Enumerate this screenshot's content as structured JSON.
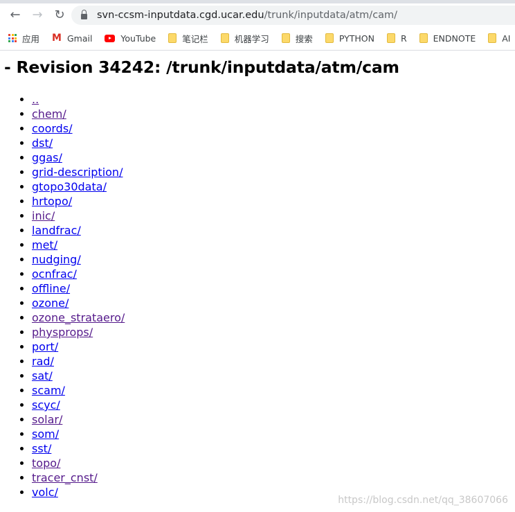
{
  "browser": {
    "url_host": "svn-ccsm-inputdata.cgd.ucar.edu",
    "url_path": "/trunk/inputdata/atm/cam/",
    "bookmarks": [
      {
        "label": "应用",
        "icon": "apps-grid-icon"
      },
      {
        "label": "Gmail",
        "icon": "gmail-icon"
      },
      {
        "label": "YouTube",
        "icon": "youtube-icon"
      },
      {
        "label": "笔记栏",
        "icon": "folder-icon"
      },
      {
        "label": "机器学习",
        "icon": "folder-icon"
      },
      {
        "label": "搜索",
        "icon": "folder-icon"
      },
      {
        "label": "PYTHON",
        "icon": "folder-icon"
      },
      {
        "label": "R",
        "icon": "folder-icon"
      },
      {
        "label": "ENDNOTE",
        "icon": "folder-icon"
      },
      {
        "label": "AI",
        "icon": "folder-icon"
      }
    ]
  },
  "page": {
    "title": "- Revision 34242: /trunk/inputdata/atm/cam",
    "colors": {
      "link": "#0000ee",
      "visited": "#551a8b"
    },
    "entries": [
      {
        "name": "..",
        "visited": true
      },
      {
        "name": "chem/",
        "visited": true
      },
      {
        "name": "coords/",
        "visited": false
      },
      {
        "name": "dst/",
        "visited": false
      },
      {
        "name": "ggas/",
        "visited": false
      },
      {
        "name": "grid-description/",
        "visited": false
      },
      {
        "name": "gtopo30data/",
        "visited": false
      },
      {
        "name": "hrtopo/",
        "visited": false
      },
      {
        "name": "inic/",
        "visited": true
      },
      {
        "name": "landfrac/",
        "visited": false
      },
      {
        "name": "met/",
        "visited": false
      },
      {
        "name": "nudging/",
        "visited": false
      },
      {
        "name": "ocnfrac/",
        "visited": false
      },
      {
        "name": "offline/",
        "visited": false
      },
      {
        "name": "ozone/",
        "visited": false
      },
      {
        "name": "ozone_strataero/",
        "visited": true
      },
      {
        "name": "physprops/",
        "visited": true
      },
      {
        "name": "port/",
        "visited": false
      },
      {
        "name": "rad/",
        "visited": false
      },
      {
        "name": "sat/",
        "visited": false
      },
      {
        "name": "scam/",
        "visited": false
      },
      {
        "name": "scyc/",
        "visited": false
      },
      {
        "name": "solar/",
        "visited": true
      },
      {
        "name": "som/",
        "visited": false
      },
      {
        "name": "sst/",
        "visited": false
      },
      {
        "name": "topo/",
        "visited": true
      },
      {
        "name": "tracer_cnst/",
        "visited": true
      },
      {
        "name": "volc/",
        "visited": false
      }
    ],
    "watermark": "https://blog.csdn.net/qq_38607066"
  }
}
